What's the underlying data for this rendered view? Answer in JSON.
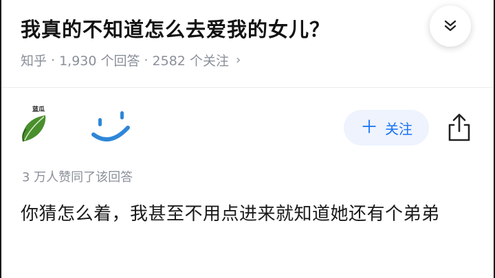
{
  "question": {
    "title": "我真的不知道怎么去爱我的女儿？",
    "source": "知乎",
    "separator": "·",
    "answers_count": "1,930 个回答",
    "followers_count": "2582 个关注",
    "chevron": "›"
  },
  "author": {
    "avatar_label": "蓝瓜",
    "avatar_icon": "green-leaf-icon",
    "name_icon": "smiley-face-icon"
  },
  "follow_button": {
    "plus": "＋",
    "label": "关注"
  },
  "answer": {
    "votes": "3 万人赞同了该回答",
    "body": "你猜怎么着，我甚至不用点进来就知道她还有个弟弟"
  },
  "colors": {
    "accent": "#1772f6",
    "follow_bg": "#eef3fd",
    "meta_text": "#8a8f99",
    "smiley_blue": "#2f86d8",
    "leaf_green": "#4a8f2e"
  }
}
